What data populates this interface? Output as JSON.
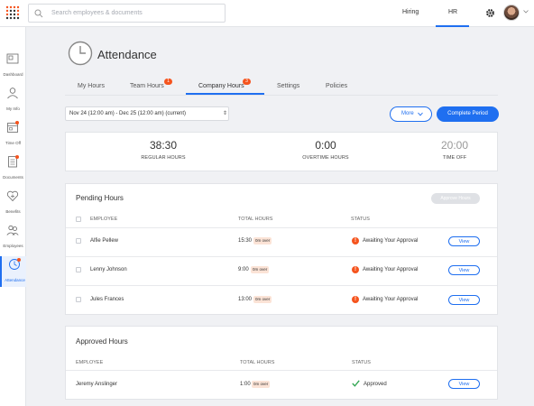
{
  "search": {
    "placeholder": "Search employees & documents"
  },
  "topnav": {
    "hiring": "Hiring",
    "hr": "HR"
  },
  "sidebar": {
    "items": [
      {
        "label": "Dashboard",
        "icon": "dashboard-icon",
        "dot": false
      },
      {
        "label": "My Info",
        "icon": "person-icon",
        "dot": false
      },
      {
        "label": "Time Off",
        "icon": "calendar-icon",
        "dot": true
      },
      {
        "label": "Documents",
        "icon": "document-icon",
        "dot": true
      },
      {
        "label": "Benefits",
        "icon": "heart-icon",
        "dot": false
      },
      {
        "label": "Employees",
        "icon": "people-icon",
        "dot": false
      },
      {
        "label": "Attendance",
        "icon": "clock-icon",
        "dot": true,
        "active": true
      }
    ]
  },
  "page": {
    "title": "Attendance"
  },
  "tabs": [
    {
      "label": "My Hours"
    },
    {
      "label": "Team Hours",
      "badge": "1"
    },
    {
      "label": "Company Hours",
      "badge": "3"
    },
    {
      "label": "Settings"
    },
    {
      "label": "Policies"
    }
  ],
  "period": {
    "value": "Nov 24 (12:00 am)  -  Dec 25 (12:00 am) (current)"
  },
  "buttons": {
    "more": "More",
    "complete": "Complete Period",
    "approve": "Approve Hours",
    "view": "View"
  },
  "summary": {
    "regular": {
      "value": "38:30",
      "label": "REGULAR HOURS"
    },
    "overtime": {
      "value": "0:00",
      "label": "OVERTIME HOURS"
    },
    "timeoff": {
      "value": "20:00",
      "label": "TIME OFF"
    }
  },
  "pending": {
    "title": "Pending Hours",
    "headers": {
      "employee": "EMPLOYEE",
      "total": "TOTAL HOURS",
      "status": "STATUS"
    },
    "rows": [
      {
        "name": "Alfie Pellew",
        "hours": "15:30",
        "over": "0m over",
        "status": "Awaiting Your Approval"
      },
      {
        "name": "Lenny Johnson",
        "hours": "9:00",
        "over": "0m over",
        "status": "Awaiting Your Approval"
      },
      {
        "name": "Jules Frances",
        "hours": "13:00",
        "over": "0m over",
        "status": "Awaiting Your Approval"
      }
    ]
  },
  "approved": {
    "title": "Approved Hours",
    "headers": {
      "employee": "EMPLOYEE",
      "total": "TOTAL HOURS",
      "status": "STATUS"
    },
    "rows": [
      {
        "name": "Jeremy Anslinger",
        "hours": "1:00",
        "over": "0m over",
        "status": "Approved"
      }
    ]
  },
  "colors": {
    "accent": "#1f6ff0",
    "alert": "#f5541e",
    "approved": "#2ea44f"
  }
}
